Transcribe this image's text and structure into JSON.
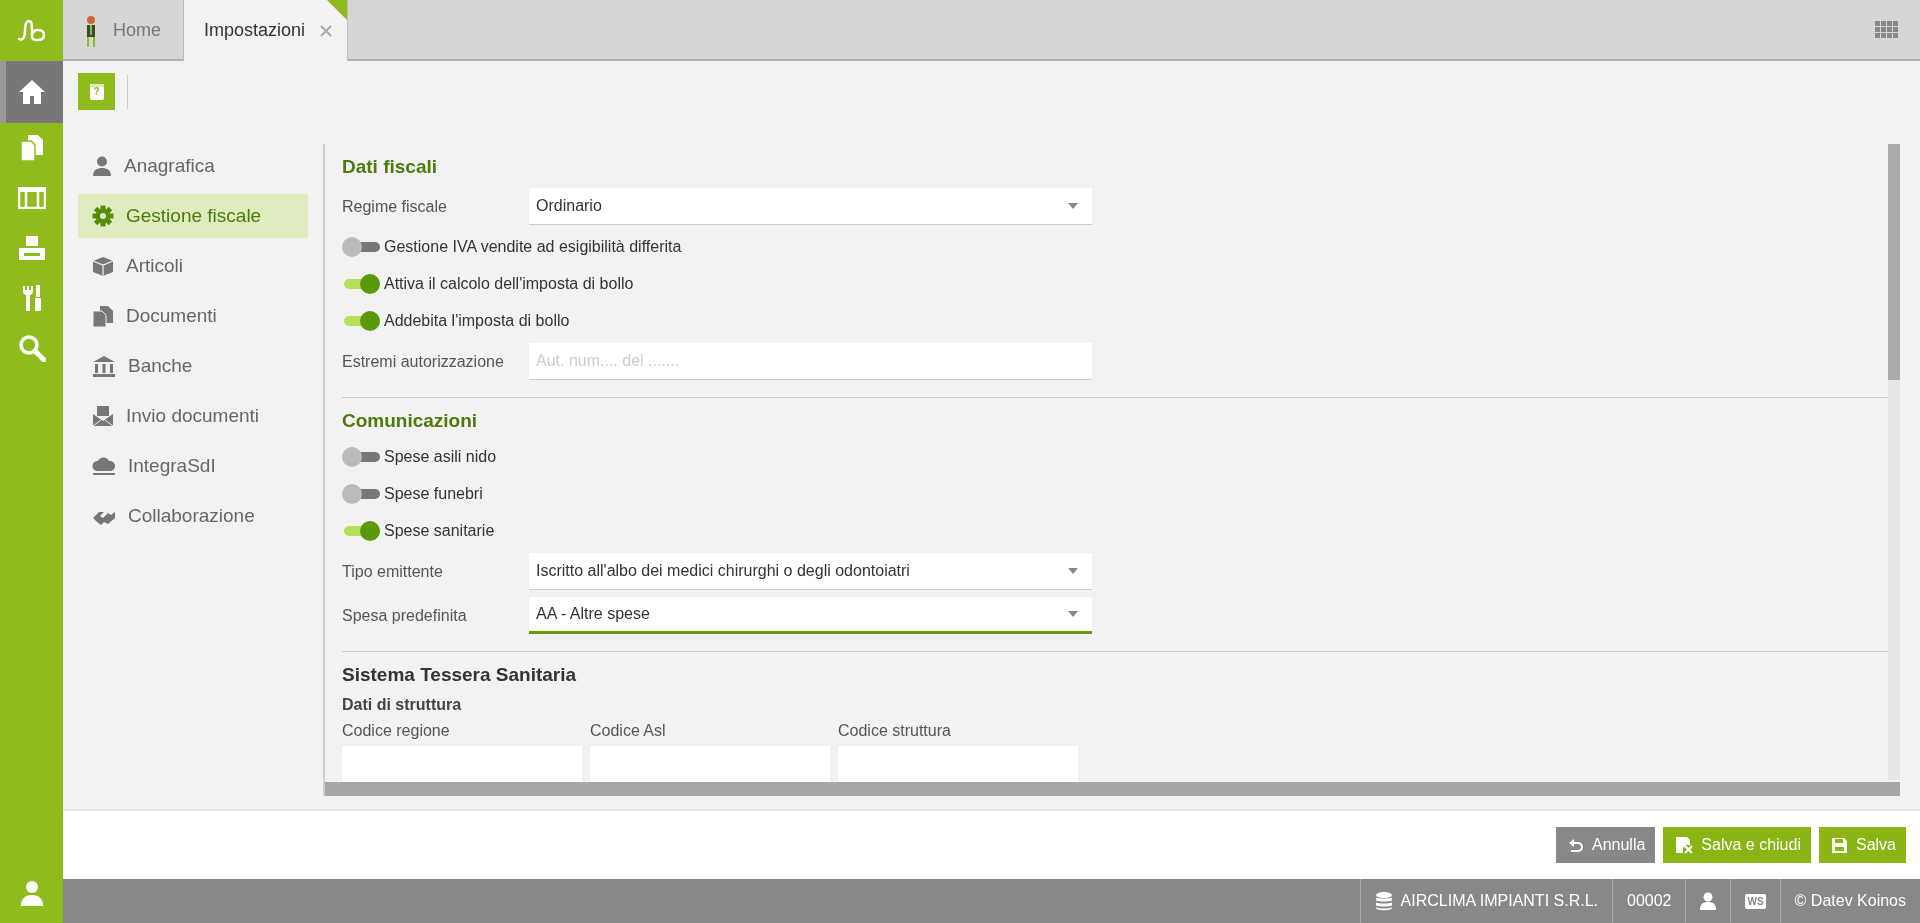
{
  "rail": {
    "items": [
      {
        "selected": true
      },
      {
        "selected": false
      },
      {
        "selected": false
      },
      {
        "selected": false
      },
      {
        "selected": false
      },
      {
        "selected": false
      }
    ]
  },
  "toolbar": {
    "help_glyph": "?"
  },
  "tabs": [
    {
      "label": "Home",
      "selected": false,
      "closable": false
    },
    {
      "label": "Impostazioni",
      "selected": true,
      "closable": true
    }
  ],
  "nav": {
    "items": [
      {
        "label": "Anagrafica",
        "selected": false
      },
      {
        "label": "Gestione fiscale",
        "selected": true
      },
      {
        "label": "Articoli",
        "selected": false
      },
      {
        "label": "Documenti",
        "selected": false
      },
      {
        "label": "Banche",
        "selected": false
      },
      {
        "label": "Invio documenti",
        "selected": false
      },
      {
        "label": "IntegraSdI",
        "selected": false
      },
      {
        "label": "Collaborazione",
        "selected": false
      }
    ]
  },
  "panel": {
    "sections": [
      {
        "title": "Dati fiscali",
        "kind": "primary",
        "rows": [
          {
            "kind": "select",
            "label": "Regime fiscale",
            "value": "Ordinario",
            "focused": false
          },
          {
            "kind": "toggle",
            "label": "Gestione IVA vendite ad esigibilità differita",
            "on": false
          },
          {
            "kind": "toggle",
            "label": "Attiva il calcolo dell'imposta di bollo",
            "on": true
          },
          {
            "kind": "toggle",
            "label": "Addebita l'imposta di bollo",
            "on": true
          },
          {
            "kind": "input",
            "label": "Estremi autorizzazione",
            "placeholder": "Aut. num.... del ......."
          }
        ]
      },
      {
        "title": "Comunicazioni",
        "kind": "primary",
        "rows": [
          {
            "kind": "toggle",
            "label": "Spese asili nido",
            "on": false
          },
          {
            "kind": "toggle",
            "label": "Spese funebri",
            "on": false
          },
          {
            "kind": "toggle",
            "label": "Spese sanitarie",
            "on": true
          },
          {
            "kind": "select",
            "label": "Tipo emittente",
            "value": "Iscritto all'albo dei medici chirurghi o degli odontoiatri",
            "focused": false
          },
          {
            "kind": "select",
            "label": "Spesa predefinita",
            "value": "AA - Altre spese",
            "focused": true
          }
        ]
      },
      {
        "title": "Sistema Tessera Sanitaria",
        "kind": "secondary",
        "subtitle": "Dati di struttura",
        "rows": [
          {
            "kind": "stacked-input",
            "label": "Codice regione"
          },
          {
            "kind": "stacked-input",
            "label": "Codice Asl"
          },
          {
            "kind": "stacked-input",
            "label": "Codice struttura"
          }
        ]
      }
    ]
  },
  "footer": {
    "buttons": [
      {
        "label": "Annulla",
        "kind": "secondary"
      },
      {
        "label": "Salva e chiudi",
        "kind": "primary"
      },
      {
        "label": "Salva",
        "kind": "primary"
      }
    ]
  },
  "status_bar": {
    "company": "AIRCLIMA IMPIANTI S.R.L.",
    "code": "00002",
    "ws_badge": "WS",
    "copyright": "© Datev Koinos"
  }
}
